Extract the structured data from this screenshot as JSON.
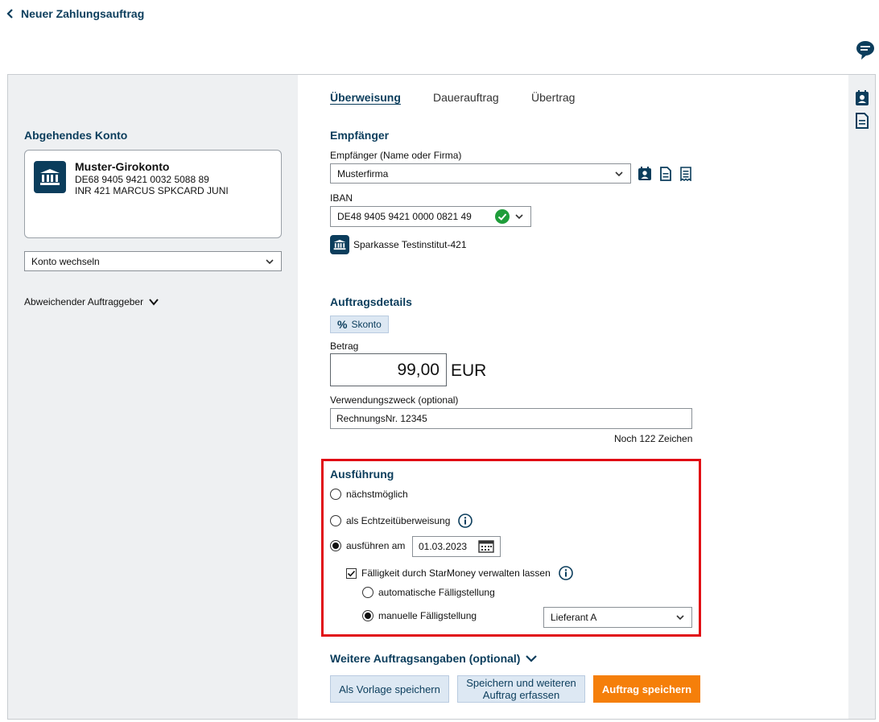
{
  "header": {
    "title": "Neuer Zahlungsauftrag"
  },
  "left": {
    "section_title": "Abgehendes Konto",
    "account": {
      "name": "Muster-Girokonto",
      "iban": "DE68 9405 9421 0032 5088 89",
      "description": "INR 421 MARCUS SPKCARD JUNI"
    },
    "change_account": "Konto wechseln",
    "alt_payer": "Abweichender Auftraggeber"
  },
  "tabs": [
    "Überweisung",
    "Dauerauftrag",
    "Übertrag"
  ],
  "recipient": {
    "section_title": "Empfänger",
    "name_label": "Empfänger (Name oder Firma)",
    "name_value": "Musterfirma",
    "iban_label": "IBAN",
    "iban_value": "DE48 9405 9421 0000 0821 49",
    "bank_name": "Sparkasse Testinstitut-421"
  },
  "details": {
    "section_title": "Auftragsdetails",
    "skonto": "Skonto",
    "amount_label": "Betrag",
    "amount_value": "99,00",
    "currency": "EUR",
    "purpose_label": "Verwendungszweck (optional)",
    "purpose_value": "RechnungsNr. 12345",
    "chars_left": "Noch 122 Zeichen"
  },
  "execution": {
    "section_title": "Ausführung",
    "opt_asap": "nächstmöglich",
    "opt_instant": "als Echtzeitüberweisung",
    "opt_date": "ausführen am",
    "date_value": "01.03.2023",
    "manage_due": "Fälligkeit durch StarMoney verwalten lassen",
    "auto_due": "automatische Fälligstellung",
    "manual_due": "manuelle Fälligstellung",
    "supplier_value": "Lieferant A",
    "selected": "ausführen am",
    "due_mode": "manuelle Fälligstellung",
    "manage_due_checked": true
  },
  "more": {
    "label": "Weitere Auftragsangaben (optional)"
  },
  "buttons": {
    "save_template": "Als Vorlage speichern",
    "save_and_new_line1": "Speichern und weiteren",
    "save_and_new_line2": "Auftrag erfassen",
    "save_order": "Auftrag speichern"
  },
  "colors": {
    "navy": "#0b3d5c",
    "accent_orange": "#f57f0a",
    "highlight_red": "#e10d14",
    "valid_green": "#1f9d3a"
  }
}
